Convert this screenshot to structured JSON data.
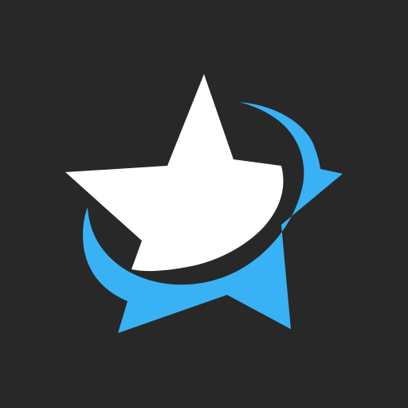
{
  "app_icon": {
    "name": "star-swoosh-logo",
    "icon": "star-icon",
    "colors": {
      "background": "#282828",
      "star": "#ffffff",
      "swoosh": "#38b2f5"
    }
  }
}
